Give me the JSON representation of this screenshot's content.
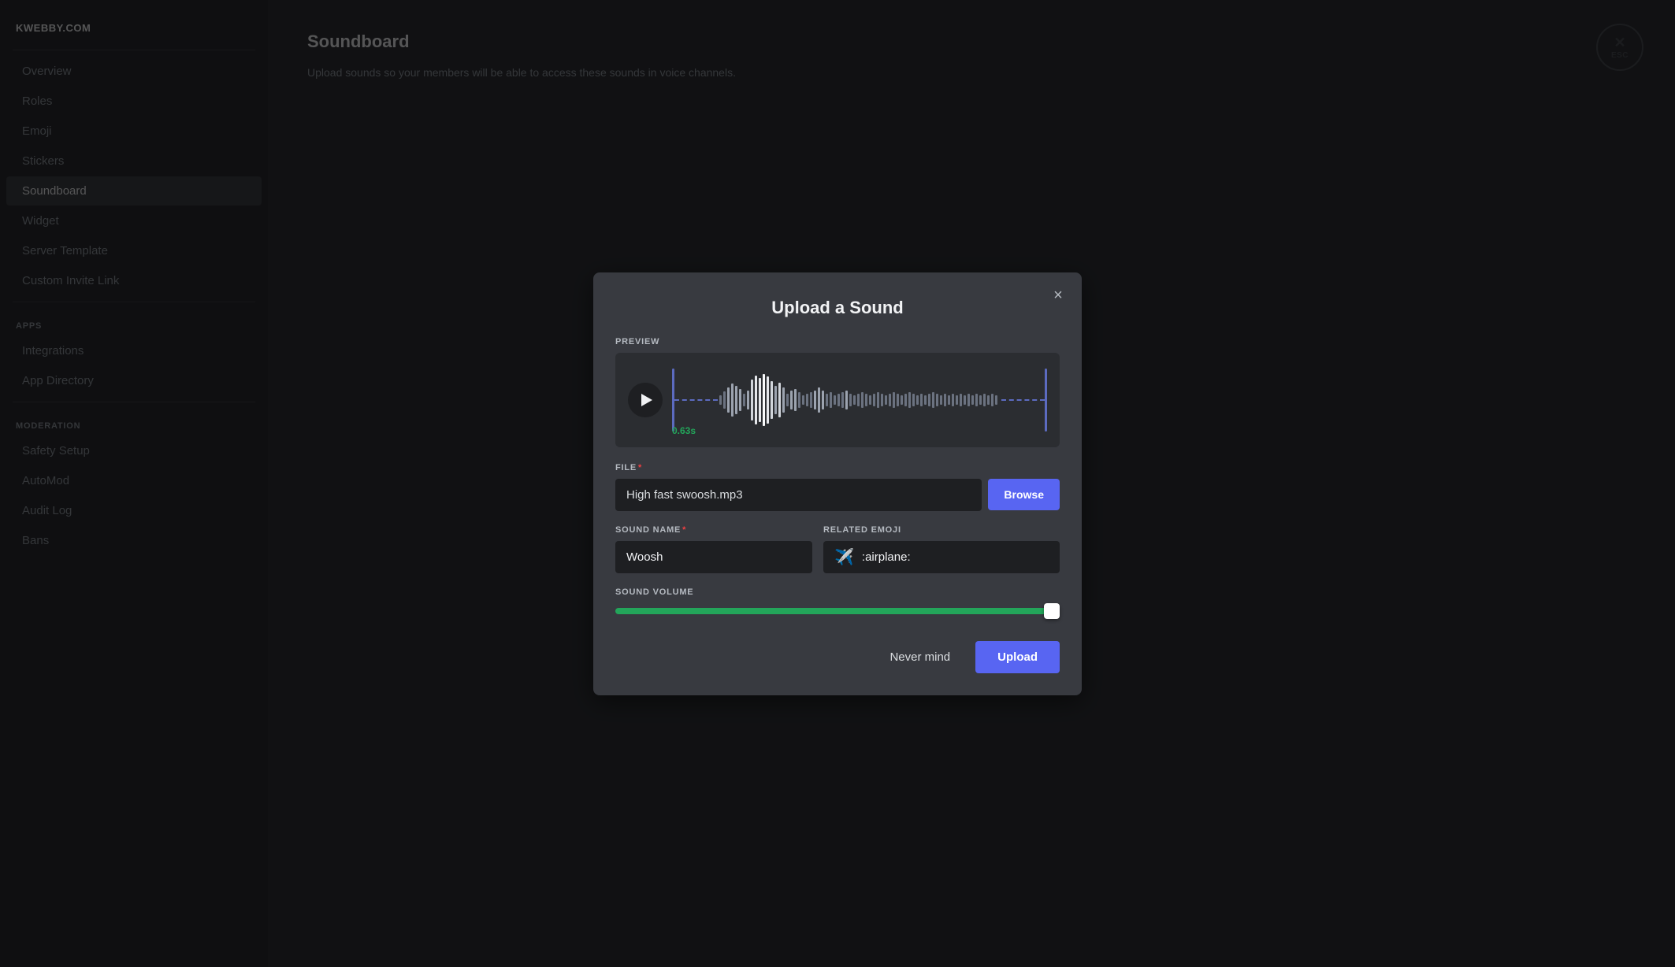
{
  "sidebar": {
    "server_name": "KWEBBY.COM",
    "items": [
      {
        "id": "overview",
        "label": "Overview",
        "active": false
      },
      {
        "id": "roles",
        "label": "Roles",
        "active": false
      },
      {
        "id": "emoji",
        "label": "Emoji",
        "active": false
      },
      {
        "id": "stickers",
        "label": "Stickers",
        "active": false
      },
      {
        "id": "soundboard",
        "label": "Soundboard",
        "active": true
      },
      {
        "id": "widget",
        "label": "Widget",
        "active": false
      },
      {
        "id": "server-template",
        "label": "Server Template",
        "active": false
      },
      {
        "id": "custom-invite-link",
        "label": "Custom Invite Link",
        "active": false
      }
    ],
    "sections": [
      {
        "label": "APPS",
        "items": [
          {
            "id": "integrations",
            "label": "Integrations"
          },
          {
            "id": "app-directory",
            "label": "App Directory"
          }
        ]
      },
      {
        "label": "MODERATION",
        "items": [
          {
            "id": "safety-setup",
            "label": "Safety Setup"
          },
          {
            "id": "automod",
            "label": "AutoMod"
          },
          {
            "id": "audit-log",
            "label": "Audit Log"
          },
          {
            "id": "bans",
            "label": "Bans"
          }
        ]
      }
    ]
  },
  "main": {
    "title": "Soundboard",
    "description": "Upload sounds so your members will be able to access these sounds in voice channels."
  },
  "esc": {
    "label": "ESC"
  },
  "modal": {
    "title": "Upload a Sound",
    "close_button": "×",
    "preview_label": "PREVIEW",
    "time": "0.63s",
    "file_label": "FILE",
    "file_required": "*",
    "file_name": "High fast swoosh.mp3",
    "browse_label": "Browse",
    "sound_name_label": "SOUND NAME",
    "sound_name_required": "*",
    "sound_name_value": "Woosh",
    "emoji_label": "RELATED EMOJI",
    "emoji_icon": "✈️",
    "emoji_value": ":airplane:",
    "volume_label": "SOUND VOLUME",
    "volume_percent": 95,
    "never_mind_label": "Never mind",
    "upload_label": "Upload"
  }
}
